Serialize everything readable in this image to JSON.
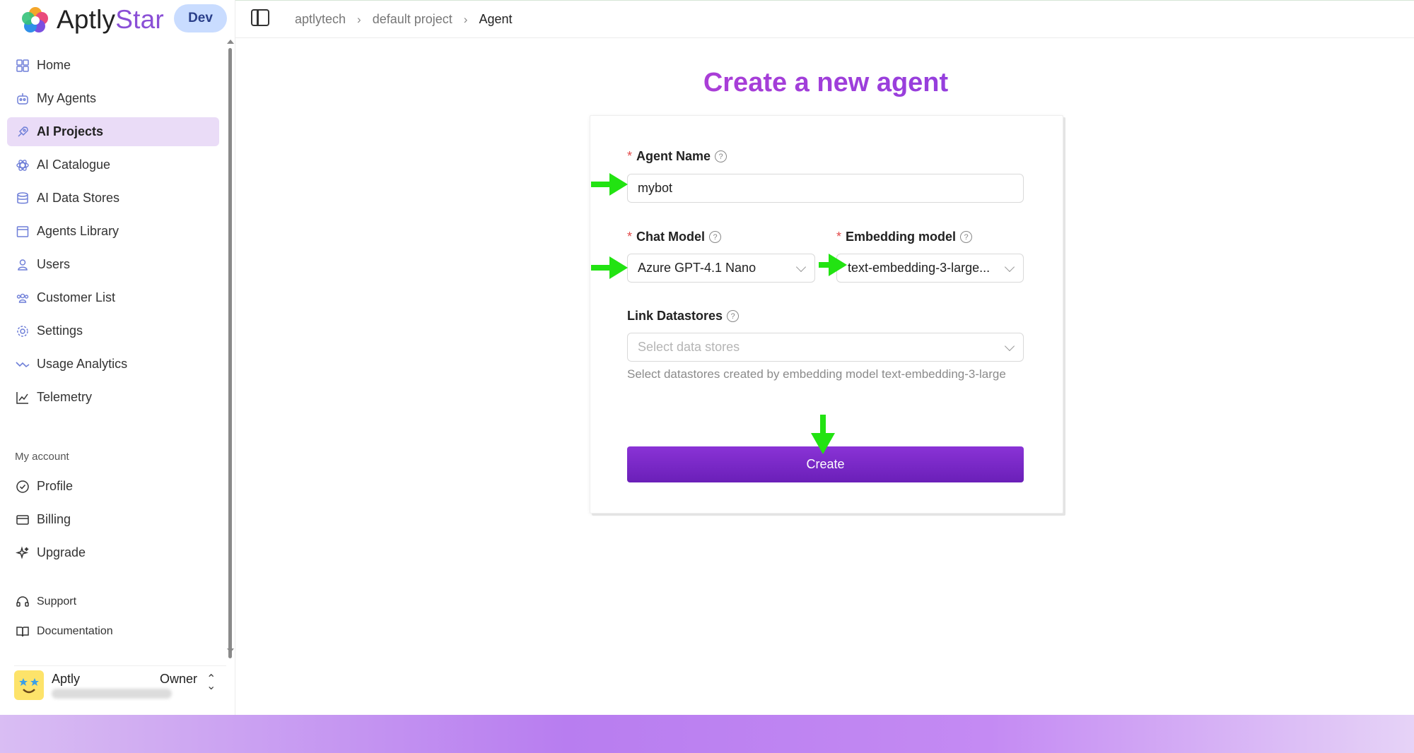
{
  "app": {
    "name_main": "Aptly",
    "name_accent": "Star",
    "env": "Dev"
  },
  "sidebar": {
    "items": [
      {
        "label": "Home",
        "icon": "home-icon"
      },
      {
        "label": "My Agents",
        "icon": "robot-icon"
      },
      {
        "label": "AI Projects",
        "icon": "rocket-icon",
        "active": true
      },
      {
        "label": "AI Catalogue",
        "icon": "atom-icon"
      },
      {
        "label": "AI Data Stores",
        "icon": "database-icon"
      },
      {
        "label": "Agents Library",
        "icon": "library-icon"
      },
      {
        "label": "Users",
        "icon": "user-icon"
      },
      {
        "label": "Customer List",
        "icon": "group-icon"
      },
      {
        "label": "Settings",
        "icon": "gear-icon"
      },
      {
        "label": "Usage Analytics",
        "icon": "trend-icon"
      },
      {
        "label": "Telemetry",
        "icon": "line-chart-icon"
      }
    ],
    "account_label": "My account",
    "account_items": [
      {
        "label": "Profile",
        "icon": "check-circle-icon"
      },
      {
        "label": "Billing",
        "icon": "credit-card-icon"
      },
      {
        "label": "Upgrade",
        "icon": "sparkle-icon"
      }
    ],
    "support_items": [
      {
        "label": "Support",
        "icon": "headset-icon"
      },
      {
        "label": "Documentation",
        "icon": "book-icon"
      }
    ],
    "user": {
      "name": "Aptly",
      "role": "Owner"
    }
  },
  "breadcrumb": {
    "items": [
      "aptlytech",
      "default project",
      "Agent"
    ]
  },
  "form": {
    "title": "Create a new agent",
    "agent_name": {
      "label": "Agent Name",
      "value": "mybot"
    },
    "chat_model": {
      "label": "Chat Model",
      "value": "Azure GPT-4.1 Nano"
    },
    "embedding_model": {
      "label": "Embedding model",
      "value": "text-embedding-3-large..."
    },
    "datastores": {
      "label": "Link Datastores",
      "placeholder": "Select data stores",
      "hint": "Select datastores created by embedding model text-embedding-3-large"
    },
    "submit_label": "Create"
  },
  "colors": {
    "accent": "#7b2bc9",
    "arrow": "#22e312",
    "active_bg": "#eadcf7"
  }
}
